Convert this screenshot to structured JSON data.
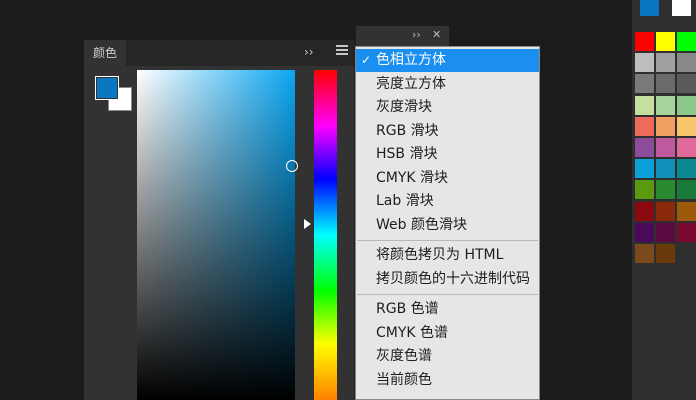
{
  "mini_header": {
    "collapse_glyph": "››",
    "close_glyph": "✕"
  },
  "color_panel": {
    "tab_label": "颜色",
    "collapse_glyph": "››",
    "foreground_color": "#0a77c2",
    "background_color": "#ffffff"
  },
  "menu": {
    "groups": [
      {
        "items": [
          {
            "label": "色相立方体",
            "checked": true,
            "selected": true
          },
          {
            "label": "亮度立方体"
          },
          {
            "label": "灰度滑块"
          },
          {
            "label": "RGB 滑块"
          },
          {
            "label": "HSB 滑块"
          },
          {
            "label": "CMYK 滑块"
          },
          {
            "label": "Lab 滑块"
          },
          {
            "label": "Web 颜色滑块"
          }
        ]
      },
      {
        "items": [
          {
            "label": "将颜色拷贝为 HTML"
          },
          {
            "label": "拷贝颜色的十六进制代码"
          }
        ]
      },
      {
        "items": [
          {
            "label": "RGB 色谱"
          },
          {
            "label": "CMYK 色谱"
          },
          {
            "label": "灰度色谱"
          },
          {
            "label": "当前颜色"
          }
        ]
      }
    ],
    "check_glyph": "✓"
  },
  "swatches": {
    "colors": [
      "#0a77c2",
      "#ffffff",
      "#ff0000",
      "#ffff00",
      "#00ff00",
      "#bdbdbd",
      "#a0a0a0",
      "#888888",
      "#7a7a7a",
      "#6a6a6a",
      "#5a5a5a",
      "#c4dfa0",
      "#a6d49a",
      "#8cc78a",
      "#ee6a5a",
      "#f0a060",
      "#f7c56c",
      "#8d4b9c",
      "#c05aa0",
      "#e06a9a",
      "#0aa0d8",
      "#1090b8",
      "#0a8a90",
      "#5a9a10",
      "#2a8a30",
      "#1a7a3a",
      "#8a0a10",
      "#8a2a0a",
      "#9a5a0a",
      "#4a0a5a",
      "#5a0a40",
      "#7a0a30",
      "#7a4a1a",
      "#6a3a0a"
    ]
  }
}
